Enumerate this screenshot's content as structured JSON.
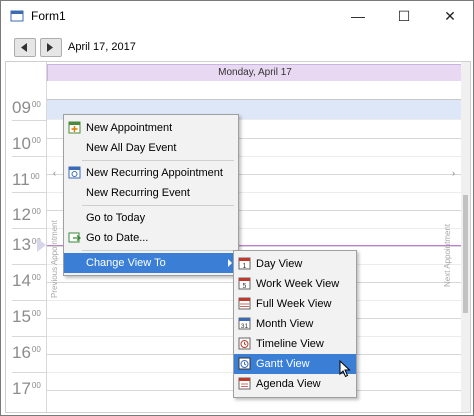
{
  "window": {
    "title": "Form1",
    "minimize": "—",
    "maximize": "☐",
    "close": "✕"
  },
  "toolbar": {
    "date": "April 17, 2017"
  },
  "scheduler": {
    "day_header": "Monday, April 17",
    "hours": [
      {
        "h": "09",
        "m": "00"
      },
      {
        "h": "10",
        "m": "00"
      },
      {
        "h": "11",
        "m": "00"
      },
      {
        "h": "12",
        "m": "00"
      },
      {
        "h": "13",
        "m": "00"
      },
      {
        "h": "14",
        "m": "00"
      },
      {
        "h": "15",
        "m": "00"
      },
      {
        "h": "16",
        "m": "00"
      },
      {
        "h": "17",
        "m": "00"
      }
    ],
    "previous_appointment": "Previous Appointment",
    "next_appointment": "Next Appointment"
  },
  "context_menu": {
    "items": [
      {
        "label": "New Appointment",
        "icon": "new-appointment-icon"
      },
      {
        "label": "New All Day Event",
        "icon": ""
      },
      {
        "label": "New Recurring Appointment",
        "icon": "recurring-appointment-icon"
      },
      {
        "label": "New Recurring Event",
        "icon": ""
      },
      {
        "label": "Go to Today",
        "icon": ""
      },
      {
        "label": "Go to Date...",
        "icon": "goto-date-icon"
      },
      {
        "label": "Change View To",
        "icon": ""
      }
    ]
  },
  "view_menu": {
    "items": [
      {
        "label": "Day View",
        "icon": "day-view-icon"
      },
      {
        "label": "Work Week View",
        "icon": "work-week-view-icon"
      },
      {
        "label": "Full Week View",
        "icon": "full-week-view-icon"
      },
      {
        "label": "Month View",
        "icon": "month-view-icon"
      },
      {
        "label": "Timeline View",
        "icon": "timeline-view-icon"
      },
      {
        "label": "Gantt View",
        "icon": "gantt-view-icon"
      },
      {
        "label": "Agenda View",
        "icon": "agenda-view-icon"
      }
    ],
    "selected": "Gantt View"
  },
  "colors": {
    "accent": "#3a7fd5",
    "day_header_bg": "#e8d8f2",
    "time_indicator": "#c27ad8",
    "selected_slot": "#dde7f8"
  }
}
